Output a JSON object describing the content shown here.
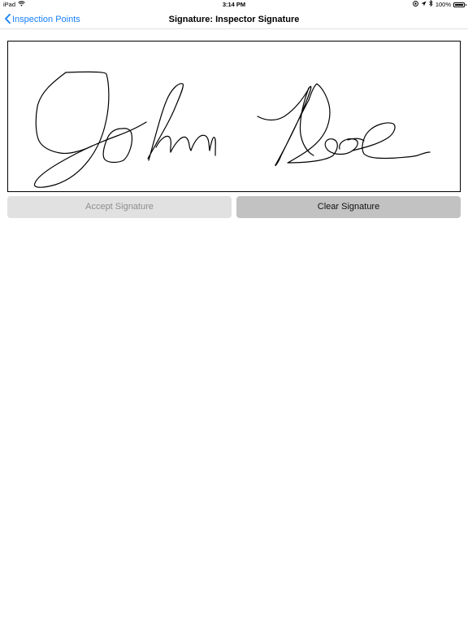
{
  "status_bar": {
    "device": "iPad",
    "time": "3:14 PM",
    "battery": "100%",
    "icons": [
      "wifi-icon",
      "location-lock-icon",
      "location-arrow-icon",
      "bluetooth-icon",
      "battery-icon"
    ]
  },
  "nav": {
    "back_label": "Inspection Points",
    "title": "Signature: Inspector Signature"
  },
  "signature": {
    "ink_color": "#000000",
    "content": "handwritten-signature"
  },
  "buttons": {
    "accept_label": "Accept Signature",
    "clear_label": "Clear Signature"
  },
  "colors": {
    "accent": "#157efb",
    "accept_bg": "#e1e1e1",
    "accept_text": "#8e8e8e",
    "clear_bg": "#c2c2c2"
  }
}
